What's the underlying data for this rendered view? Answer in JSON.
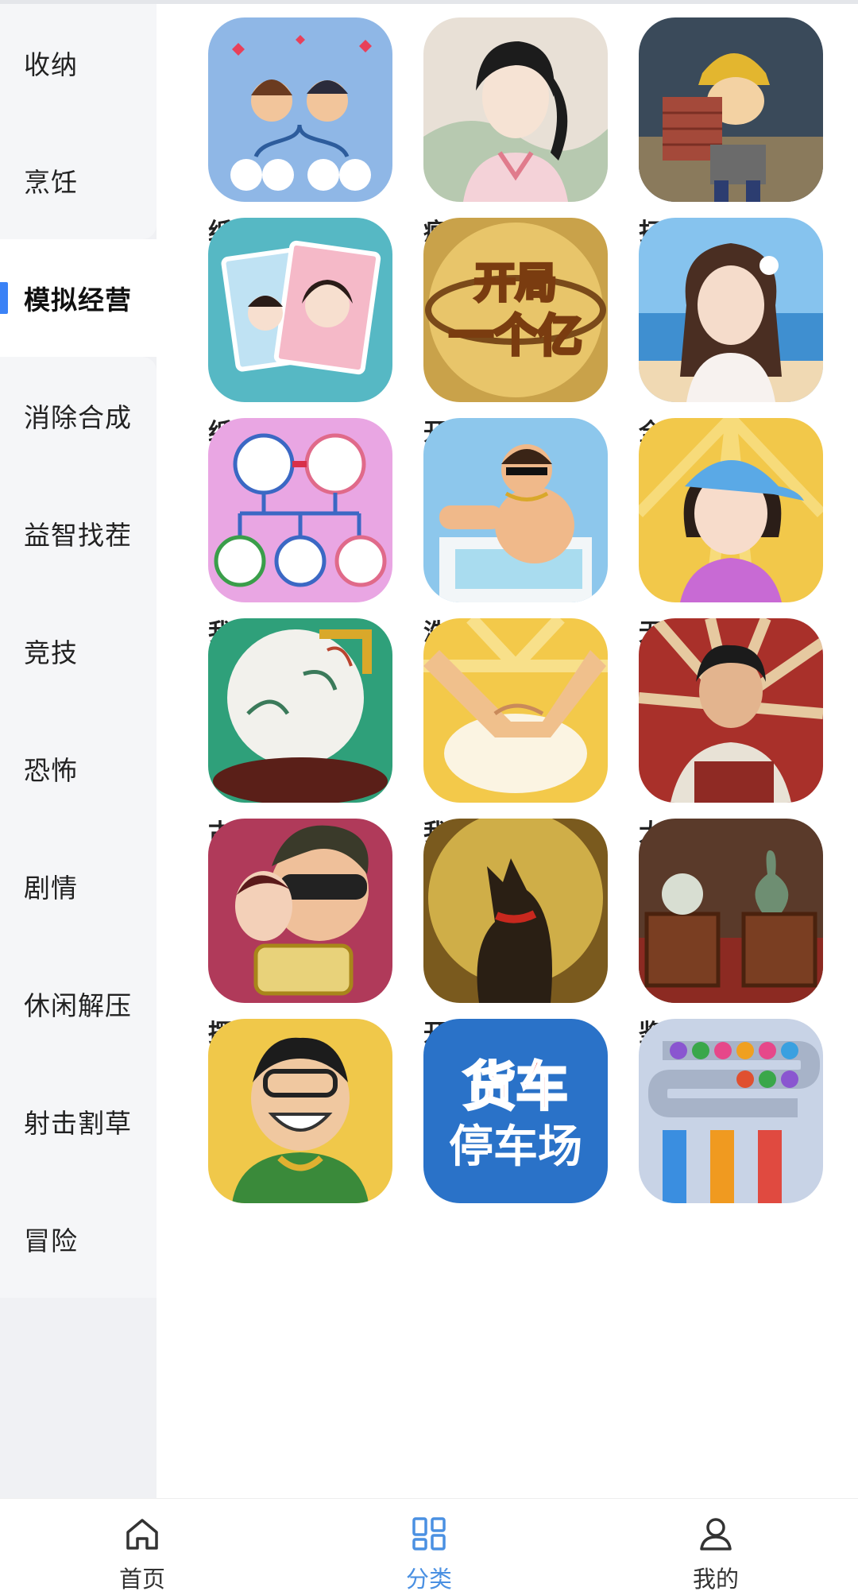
{
  "sidebar": {
    "items": [
      {
        "label": "收纳"
      },
      {
        "label": "烹饪"
      },
      {
        "label": "模拟经营",
        "active": true
      },
      {
        "label": "消除合成"
      },
      {
        "label": "益智找茬"
      },
      {
        "label": "竞技"
      },
      {
        "label": "恐怖"
      },
      {
        "label": "剧情"
      },
      {
        "label": "休闲解压"
      },
      {
        "label": "射击割草"
      },
      {
        "label": "冒险"
      }
    ]
  },
  "games": [
    {
      "name": "纸牌人生-免...",
      "icon": "couple-family-tree-icon"
    },
    {
      "name": "疯狂模拟器/...",
      "icon": "swordsman-portrait-icon"
    },
    {
      "name": "打工生活模...",
      "icon": "construction-worker-icon"
    },
    {
      "name": "纸牌人生-免...",
      "icon": "photo-cards-icon"
    },
    {
      "name": "开局一个亿-...",
      "icon": "gold-text-logo-icon"
    },
    {
      "name": "全民摆摊-免...",
      "icon": "beach-girl-icon"
    },
    {
      "name": "我要做网红-...",
      "icon": "family-tree-icon"
    },
    {
      "name": "洗浴中心模...",
      "icon": "bathing-man-icon"
    },
    {
      "name": "无聊人生-免...",
      "icon": "cap-girl-icon"
    },
    {
      "name": "古董大师模...",
      "icon": "porcelain-vase-icon"
    },
    {
      "name": "我的摆摊日...",
      "icon": "dough-hands-icon"
    },
    {
      "name": "大排档模拟...",
      "icon": "reading-man-icon"
    },
    {
      "name": "摆摊高手-免...",
      "icon": "rich-man-glasses-icon"
    },
    {
      "name": "开局一条狗-...",
      "icon": "dog-silhouette-icon"
    },
    {
      "name": "鉴宝模拟器-...",
      "icon": "treasure-chests-icon"
    },
    {
      "name": "",
      "icon": "grinning-rich-man-icon"
    },
    {
      "name": "",
      "icon": "truck-parking-icon",
      "icon_text_line1": "货车",
      "icon_text_line2": "停车场"
    },
    {
      "name": "",
      "icon": "ball-sort-icon"
    }
  ],
  "bottom_nav": [
    {
      "label": "首页",
      "icon": "home-icon"
    },
    {
      "label": "分类",
      "icon": "category-grid-icon",
      "active": true
    },
    {
      "label": "我的",
      "icon": "profile-icon"
    }
  ],
  "colors": {
    "accent": "#4a90e2",
    "sidebar_bg": "#f5f6f8",
    "active_bar": "#3b82f6"
  }
}
